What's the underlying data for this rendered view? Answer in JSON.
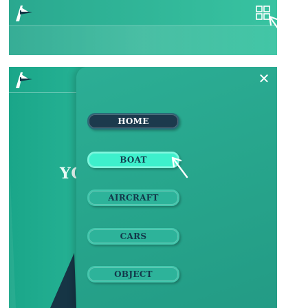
{
  "top": {
    "logo_icon": "airplane-logo-icon",
    "menu_icon": "grid-menu-icon"
  },
  "bottom": {
    "logo_icon": "airplane-logo-icon",
    "background_text": "YC",
    "close_label": "✕"
  },
  "menu": {
    "items": [
      {
        "label": "HOME",
        "state": "selected"
      },
      {
        "label": "BOAT",
        "state": "hover"
      },
      {
        "label": "AIRCRAFT",
        "state": "default"
      },
      {
        "label": "CARS",
        "state": "default"
      },
      {
        "label": "OBJECT",
        "state": "default"
      }
    ]
  },
  "colors": {
    "teal_bg": "#2fb396",
    "menu_bg": "#27a58c",
    "home_bg": "#1c3a4d",
    "boat_bg": "#3ef0cc"
  }
}
